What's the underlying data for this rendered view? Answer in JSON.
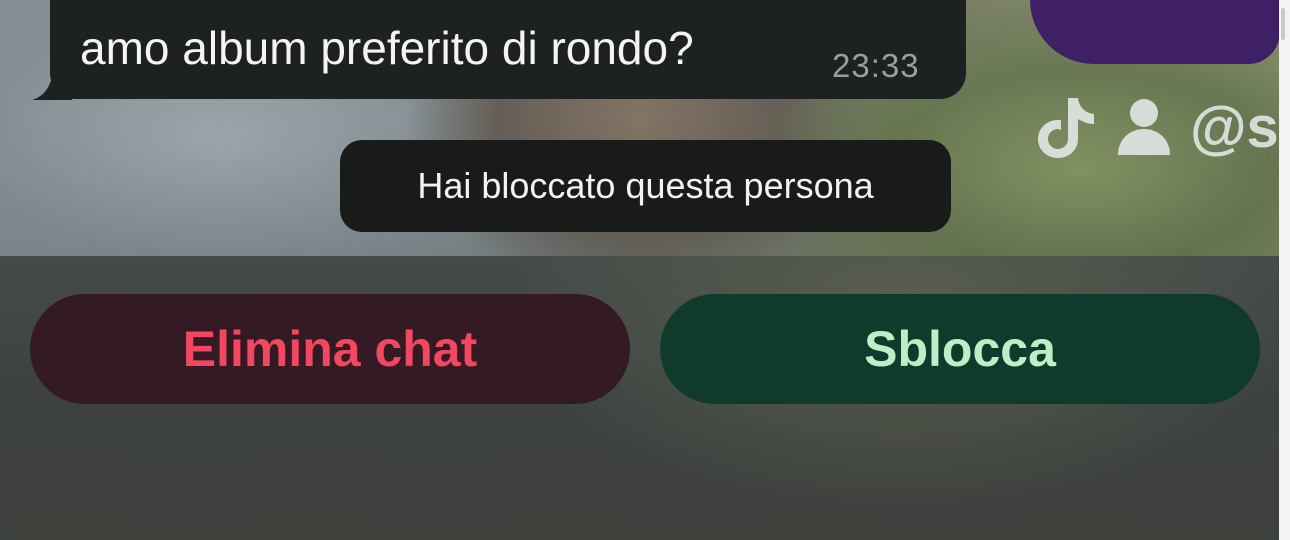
{
  "message": {
    "text": "amo album preferito di rondo?",
    "time": "23:33"
  },
  "watermark": {
    "platform_icon": "tiktok-icon",
    "user_icon": "person-icon",
    "handle": "@s"
  },
  "system_notice": {
    "text": "Hai bloccato questa persona"
  },
  "actions": {
    "delete_label": "Elimina chat",
    "unblock_label": "Sblocca"
  },
  "colors": {
    "delete_text": "#f3465f",
    "delete_bg": "#341a24",
    "unblock_text": "#b9f0c5",
    "unblock_bg": "#0f3a2c",
    "bubble_bg": "#1e2121"
  }
}
